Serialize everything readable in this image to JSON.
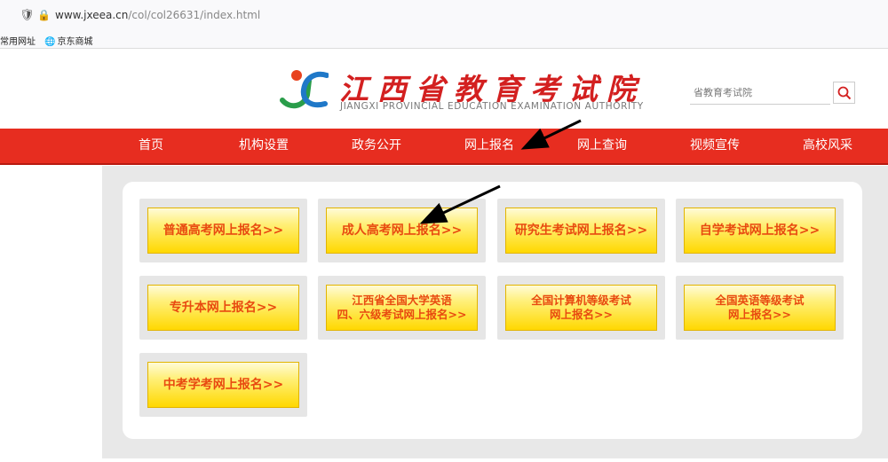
{
  "browser": {
    "url_host": "www.jxeea.cn",
    "url_path": "/col/col26631/index.html"
  },
  "bookmarks": [
    "常用网址",
    "京东商城"
  ],
  "header": {
    "logo_cn": "江西省教育考试院",
    "logo_en": "JIANGXI PROVINCIAL EDUCATION EXAMINATION AUTHORITY",
    "search_placeholder": "省教育考试院"
  },
  "nav": [
    "首页",
    "机构设置",
    "政务公开",
    "网上报名",
    "网上查询",
    "视频宣传",
    "高校风采"
  ],
  "buttons": [
    "普通高考网上报名>>",
    "成人高考网上报名>>",
    "研究生考试网上报名>>",
    "自学考试网上报名>>",
    "专升本网上报名>>",
    "江西省全国大学英语\n四、六级考试网上报名>>",
    "全国计算机等级考试\n网上报名>>",
    "全国英语等级考试\n网上报名>>",
    "中考学考网上报名>>"
  ],
  "colors": {
    "nav_red": "#e72d20",
    "button_text": "#e84a10",
    "logo_red": "#d32020"
  }
}
